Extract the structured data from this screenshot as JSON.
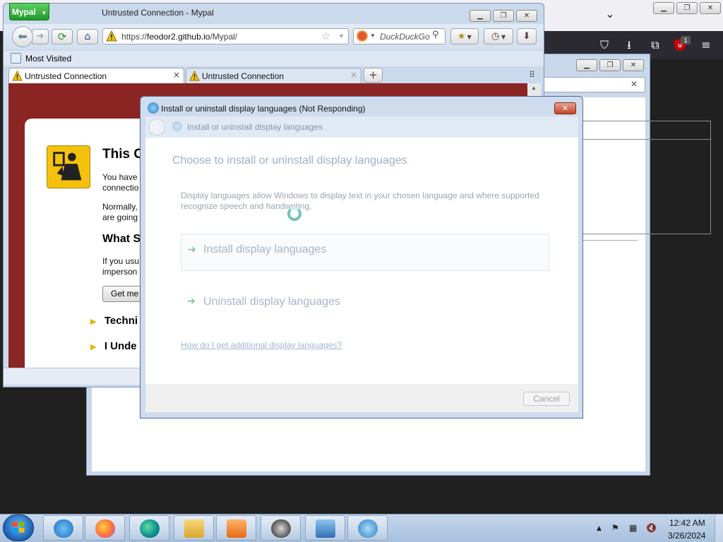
{
  "colors": {
    "accent_green": "#1f9b2a",
    "error_red": "#8b2523",
    "taskbar": "#b7cce4",
    "warning_yellow": "#f4c20d"
  },
  "firefox": {
    "badge_count": "1",
    "icons": [
      "shield-icon",
      "download-icon",
      "extensions-icon",
      "ublock-icon",
      "menu-icon"
    ]
  },
  "mypal": {
    "app_button": "Mypal",
    "title": "Untrusted Connection - Mypal",
    "url_prefix": "https://",
    "url_host": "feodor2.github.io",
    "url_path": "/Mypal/",
    "search_placeholder": "DuckDuckGo",
    "bookmark": "Most Visited",
    "tabs": [
      {
        "label": "Untrusted Connection",
        "close": "×"
      },
      {
        "label": "Untrusted Connection",
        "close": "×"
      }
    ],
    "new_tab": "+",
    "page": {
      "heading": "This C",
      "p1_line1": "You have",
      "p1_line2": "connectio",
      "p2_line1": "Normally,",
      "p2_line2": "are going",
      "subheading": "What S",
      "p3_line1": "If you usu",
      "p3_line2": "imperson",
      "get_me_button": "Get me",
      "expander1": "Techni",
      "expander2": "I Unde"
    }
  },
  "dialog": {
    "title": "Install or uninstall display languages (Not Responding)",
    "nav_title": "Install or uninstall display languages",
    "heading": "Choose to install or uninstall display languages",
    "description_line1": "Display languages allow Windows to display text in your chosen language and where supported",
    "description_line2": "recognize speech and handwriting.",
    "options": [
      "Install display languages",
      "Uninstall display languages"
    ],
    "help_link": "How do I get additional display languages?",
    "cancel": "Cancel",
    "close": "✕"
  },
  "taskbar": {
    "time": "12:42 AM",
    "date": "3/26/2024",
    "apps": [
      "internet-explorer",
      "firefox",
      "edge",
      "file-explorer",
      "media-player",
      "raccoon-app",
      "control-panel",
      "language-settings"
    ]
  }
}
